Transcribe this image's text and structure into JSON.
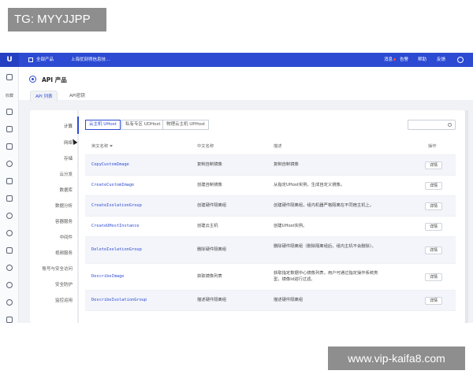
{
  "watermarks": {
    "top": "TG: MYYJJPP",
    "bottom": "www.vip-kaifa8.com"
  },
  "topbar": {
    "logo": "U",
    "all_products": "全部产品",
    "org": "上海优刻得信息技...",
    "messages": "消息",
    "alerts": "告警",
    "help": "帮助",
    "feedback": "反馈"
  },
  "leftnav": {
    "items": [
      {
        "label": "收藏"
      }
    ]
  },
  "page_title": "API 产品",
  "tabs": [
    {
      "label": "API 列表",
      "active": true
    },
    {
      "label": "API密钥",
      "active": false
    }
  ],
  "categories": [
    {
      "label": "计算",
      "active": true
    },
    {
      "label": "网络"
    },
    {
      "label": "存储"
    },
    {
      "label": "云分发"
    },
    {
      "label": "数据库"
    },
    {
      "label": "数据分析"
    },
    {
      "label": "容器服务"
    },
    {
      "label": "中间件"
    },
    {
      "label": "视频服务"
    },
    {
      "label": "账号与安全访问"
    },
    {
      "label": "安全防护"
    },
    {
      "label": "监控运用"
    }
  ],
  "filters": [
    {
      "label": "云主机 UHost",
      "active": true
    },
    {
      "label": "私有专区 UDHost"
    },
    {
      "label": "物理云主机 UPHost"
    }
  ],
  "search": {
    "placeholder": ""
  },
  "table": {
    "headers": {
      "en_name": "英文名称",
      "cn_name": "中文名称",
      "desc": "描述",
      "action": "操作"
    },
    "rows": [
      {
        "en": "CopyCustomImage",
        "cn": "复制自制镜像",
        "desc": "复制自制镜像",
        "action": "详情"
      },
      {
        "en": "CreateCustomImage",
        "cn": "创建自制镜像",
        "desc": "从指定UHost实例，生成自定义镜像。",
        "action": "详情"
      },
      {
        "en": "CreateIsolationGroup",
        "cn": "创建硬件隔离组",
        "desc": "创建硬件隔离组，组内机器严格隔离在不同宿主机上。",
        "action": "详情"
      },
      {
        "en": "CreateUHostInstance",
        "cn": "创建云主机",
        "desc": "创建UHost实例。",
        "action": "详情"
      },
      {
        "en": "DeleteIsolationGroup",
        "cn": "删除硬件隔离组",
        "desc": "删除硬件隔离组（删除隔离组后，组内主机不会删除）。",
        "action": "详情"
      },
      {
        "en": "DescribeImage",
        "cn": "获取镜像列表",
        "desc": "获取指定数据中心镜像列表，用户可通过指定操作系统类型，镜像Id进行过滤。",
        "action": "详情"
      },
      {
        "en": "DescribeIsolationGroup",
        "cn": "描述硬件隔离组",
        "desc": "描述硬件隔离组",
        "action": "详情"
      }
    ]
  }
}
